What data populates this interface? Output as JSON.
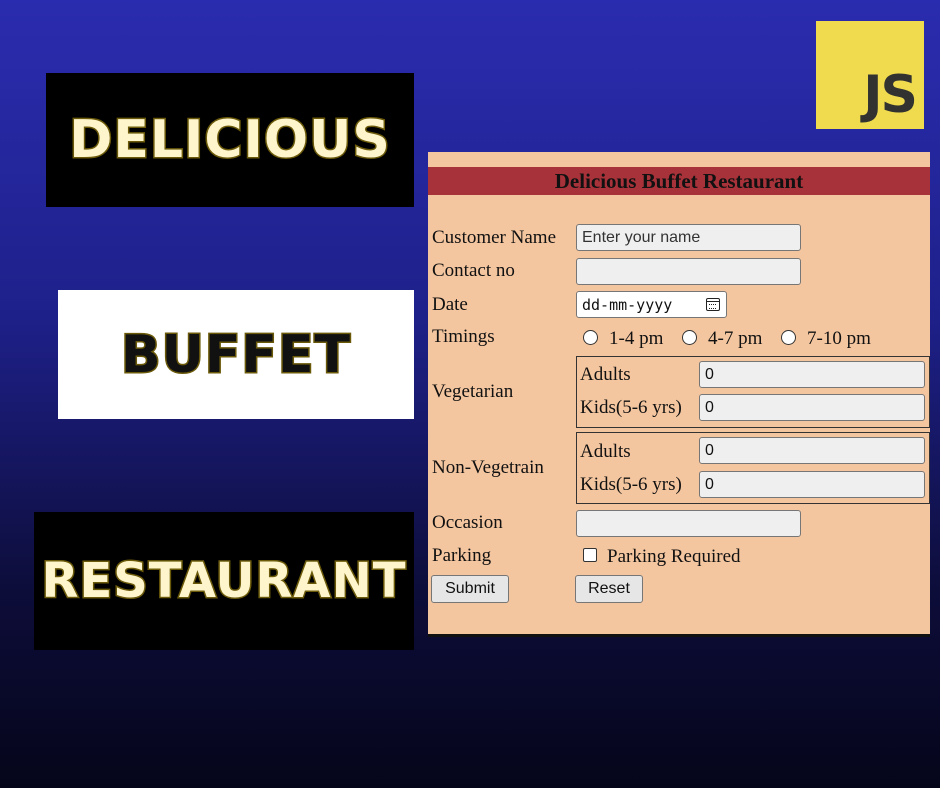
{
  "banners": {
    "line1": "DELICIOUS",
    "line2": "BUFFET",
    "line3": "RESTAURANT"
  },
  "logo": {
    "text": "JS"
  },
  "form": {
    "title": "Delicious Buffet Restaurant",
    "customer_name": {
      "label": "Customer Name",
      "placeholder": "Enter your name",
      "value": ""
    },
    "contact": {
      "label": "Contact no",
      "value": ""
    },
    "date": {
      "label": "Date",
      "placeholder": "dd-mm-yyyy"
    },
    "timings": {
      "label": "Timings",
      "options": [
        "1-4 pm",
        "4-7 pm",
        "7-10 pm"
      ]
    },
    "vegetarian": {
      "label": "Vegetarian",
      "adults_label": "Adults",
      "adults_value": "0",
      "kids_label": "Kids(5-6 yrs)",
      "kids_value": "0"
    },
    "non_veg": {
      "label": "Non-Vegetrain",
      "adults_label": "Adults",
      "adults_value": "0",
      "kids_label": "Kids(5-6 yrs)",
      "kids_value": "0"
    },
    "occasion": {
      "label": "Occasion",
      "value": ""
    },
    "parking": {
      "label": "Parking",
      "option": "Parking Required"
    },
    "submit_label": "Submit",
    "reset_label": "Reset"
  }
}
